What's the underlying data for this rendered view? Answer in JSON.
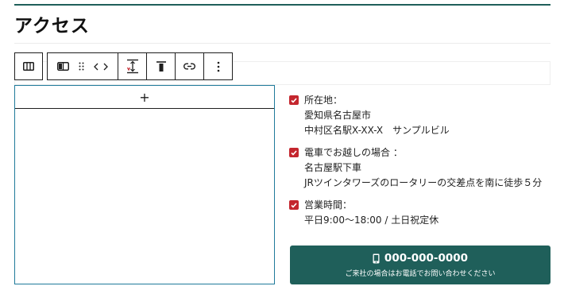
{
  "heading": "アクセス",
  "toolbar": {
    "icons": [
      "columns-icon",
      "block-type-icon",
      "drag-handle-icon",
      "move-arrows-icon",
      "vertical-spacing-icon",
      "align-top-icon",
      "link-icon",
      "more-options-icon"
    ]
  },
  "map_block": {
    "add_label": "+"
  },
  "info_items": [
    {
      "lines": [
        "所在地：",
        "愛知県名古屋市",
        "中村区名駅X-XX-X　サンプルビル"
      ]
    },
    {
      "lines": [
        "電車でお越しの場合 ：",
        "名古屋駅下車",
        "JRツインタワーズのロータリーの交差点を南に徒歩５分"
      ]
    },
    {
      "lines": [
        "営業時間：",
        "平日9:00～18:00 / 土日祝定休"
      ]
    }
  ],
  "cta": {
    "phone": "000-000-0000",
    "note": "ご来社の場合はお電話でお問い合わせください"
  },
  "colors": {
    "accent": "#1f5f5a",
    "check": "#c4262e",
    "block_border": "#1f7a9a"
  }
}
